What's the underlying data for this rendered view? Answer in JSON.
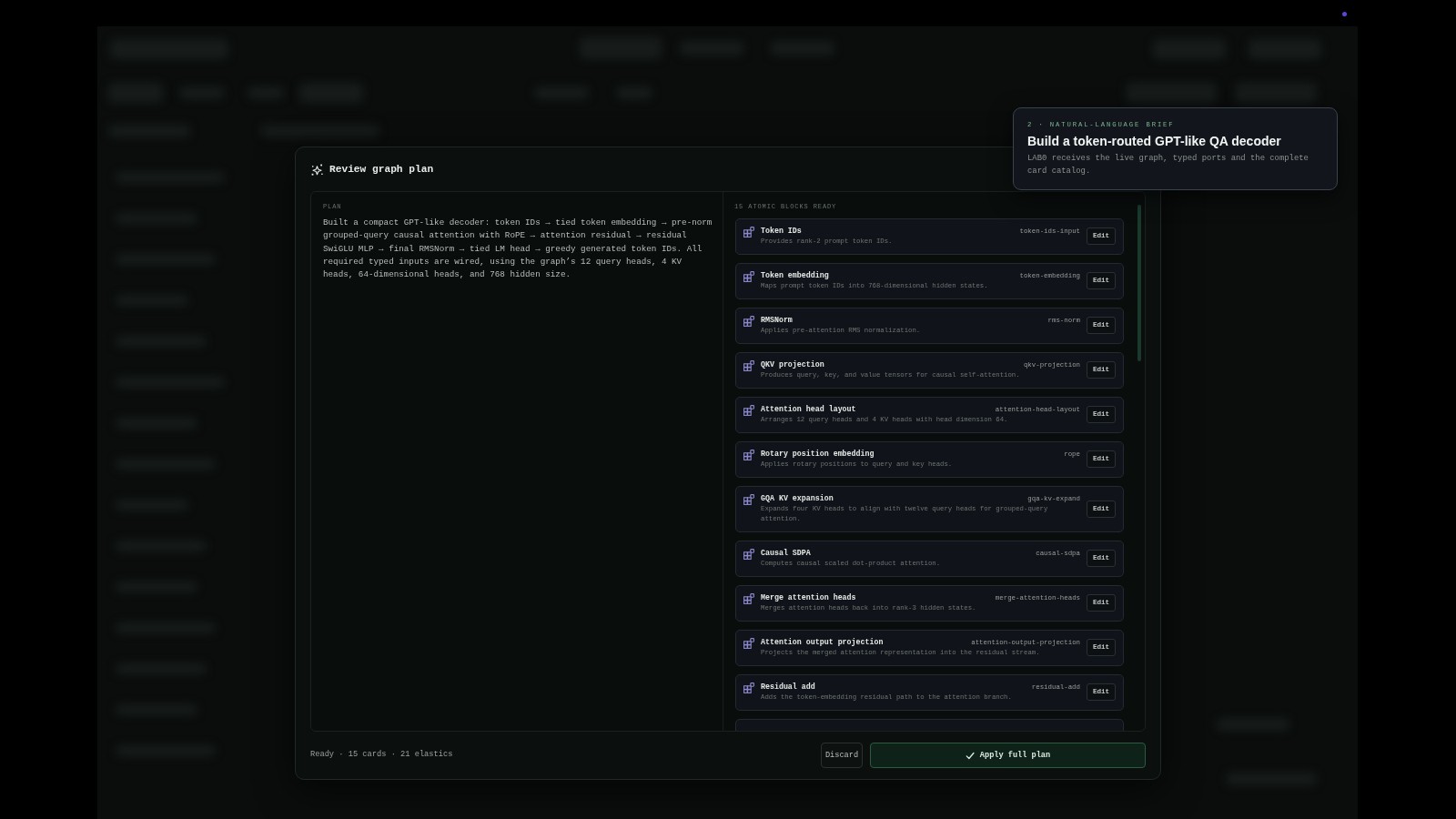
{
  "brief": {
    "eyebrow": "2 · NATURAL-LANGUAGE BRIEF",
    "title": "Build a token-routed GPT-like QA decoder",
    "description": "LAB0 receives the live graph, typed ports and the complete card catalog."
  },
  "modal": {
    "title": "Review graph plan",
    "plan": {
      "label": "PLAN",
      "text": "Built a compact GPT-like decoder: token IDs → tied token embedding → pre-norm grouped-query causal attention with RoPE → attention residual → residual SwiGLU MLP → final RMSNorm → tied LM head → greedy generated token IDs. All required typed inputs are wired, using the graph’s 12 query heads, 4 KV heads, 64-dimensional heads, and 768 hidden size."
    },
    "blocks": {
      "heading": "15 ATOMIC BLOCKS READY",
      "items": [
        {
          "title": "Token IDs",
          "slug": "token-ids-input",
          "description": "Provides rank-2 prompt token IDs.",
          "action": "Edit"
        },
        {
          "title": "Token embedding",
          "slug": "token-embedding",
          "description": "Maps prompt token IDs into 768-dimensional hidden states.",
          "action": "Edit"
        },
        {
          "title": "RMSNorm",
          "slug": "rms-norm",
          "description": "Applies pre-attention RMS normalization.",
          "action": "Edit"
        },
        {
          "title": "QKV projection",
          "slug": "qkv-projection",
          "description": "Produces query, key, and value tensors for causal self-attention.",
          "action": "Edit"
        },
        {
          "title": "Attention head layout",
          "slug": "attention-head-layout",
          "description": "Arranges 12 query heads and 4 KV heads with head dimension 64.",
          "action": "Edit"
        },
        {
          "title": "Rotary position embedding",
          "slug": "rope",
          "description": "Applies rotary positions to query and key heads.",
          "action": "Edit"
        },
        {
          "title": "GQA KV expansion",
          "slug": "gqa-kv-expand",
          "description": "Expands four KV heads to align with twelve query heads for grouped-query attention.",
          "action": "Edit"
        },
        {
          "title": "Causal SDPA",
          "slug": "causal-sdpa",
          "description": "Computes causal scaled dot-product attention.",
          "action": "Edit"
        },
        {
          "title": "Merge attention heads",
          "slug": "merge-attention-heads",
          "description": "Merges attention heads back into rank-3 hidden states.",
          "action": "Edit"
        },
        {
          "title": "Attention output projection",
          "slug": "attention-output-projection",
          "description": "Projects the merged attention representation into the residual stream.",
          "action": "Edit"
        },
        {
          "title": "Residual add",
          "slug": "residual-add",
          "description": "Adds the token-embedding residual path to the attention branch.",
          "action": "Edit"
        }
      ]
    },
    "status": "Ready · 15 cards · 21 elastics",
    "buttons": [
      {
        "label": "Discard",
        "kind": "secondary"
      },
      {
        "label": "Apply full plan",
        "kind": "primary"
      }
    ]
  }
}
